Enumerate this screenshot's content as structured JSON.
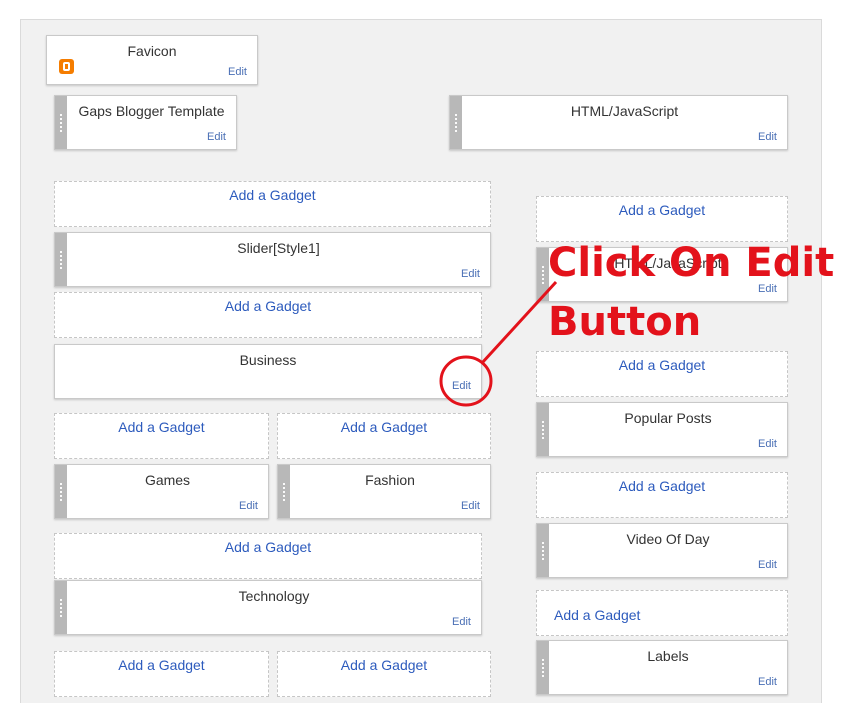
{
  "gadgets": {
    "favicon": {
      "title": "Favicon",
      "edit": "Edit",
      "icon": "blogger-icon"
    },
    "gaps_template": {
      "title": "Gaps Blogger Template",
      "edit": "Edit"
    },
    "html_js_top": {
      "title": "HTML/JavaScript",
      "edit": "Edit"
    },
    "slider": {
      "title": "Slider[Style1]",
      "edit": "Edit"
    },
    "business": {
      "title": "Business",
      "edit": "Edit"
    },
    "games": {
      "title": "Games",
      "edit": "Edit"
    },
    "fashion": {
      "title": "Fashion",
      "edit": "Edit"
    },
    "technology": {
      "title": "Technology",
      "edit": "Edit"
    },
    "html_js_right": {
      "title": "HTML/JavaScript",
      "edit": "Edit"
    },
    "popular_posts": {
      "title": "Popular Posts",
      "edit": "Edit"
    },
    "video_of_day": {
      "title": "Video Of Day",
      "edit": "Edit"
    },
    "labels": {
      "title": "Labels",
      "edit": "Edit"
    }
  },
  "add_gadget_label": "Add a Gadget",
  "annotation": {
    "line1": "Click On Edit",
    "line2": "Button",
    "color": "#e3121b"
  },
  "colors": {
    "link": "#2d5bbd",
    "edit": "#4a6fb5",
    "handle": "#b8b8b8",
    "canvas": "#f1f1f1",
    "blogger": "#f57d00"
  }
}
